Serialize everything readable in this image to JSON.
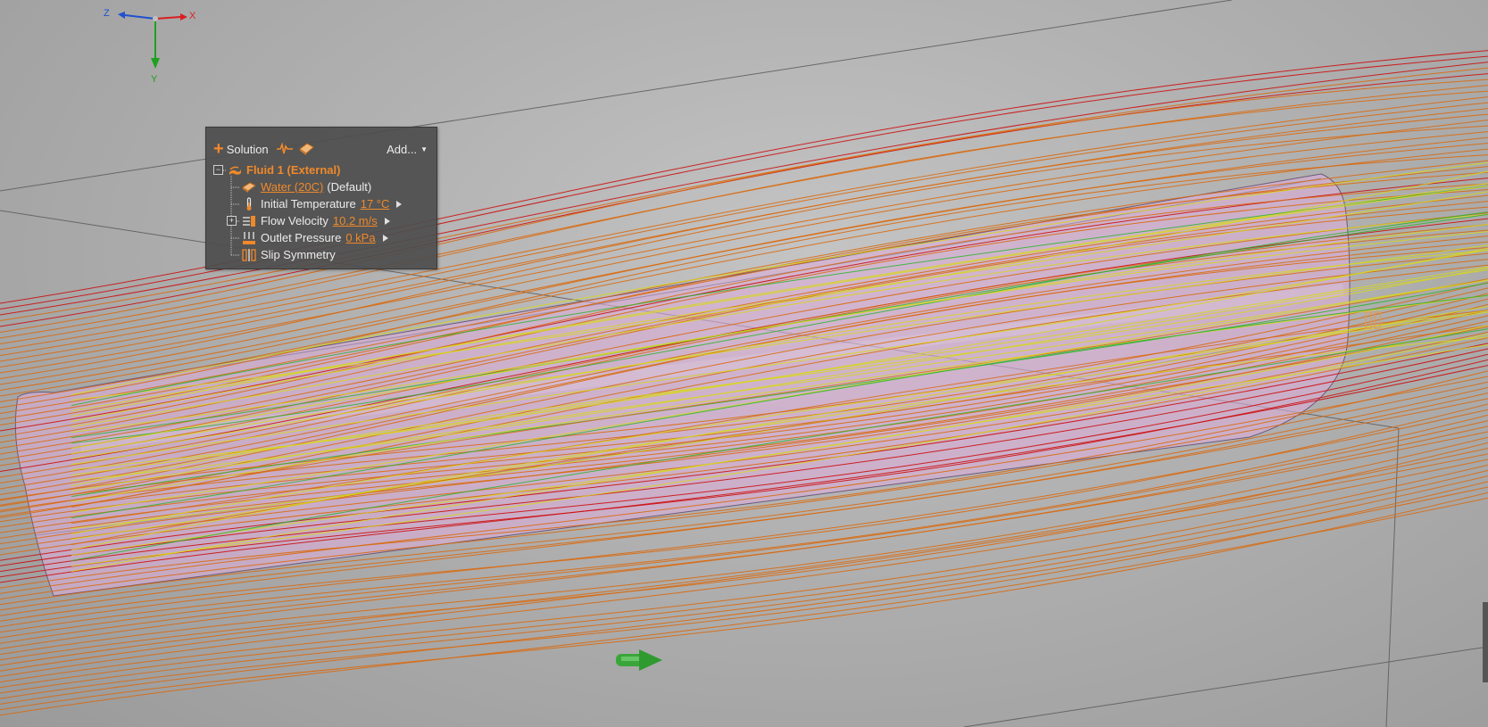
{
  "axis": {
    "x_label": "X",
    "y_label": "Y",
    "z_label": "Z"
  },
  "panel": {
    "header": {
      "solution_label": "Solution",
      "add_label": "Add..."
    },
    "fluid": {
      "label": "Fluid 1 (External)",
      "material": {
        "link": "Water (20C)",
        "suffix": "(Default)"
      },
      "rows": [
        {
          "label": "Initial Temperature",
          "value": "17 °C"
        },
        {
          "label": "Flow Velocity",
          "value": "10.2 m/s"
        },
        {
          "label": "Outlet Pressure",
          "value": "0 kPa"
        },
        {
          "label": "Slip Symmetry"
        }
      ]
    }
  },
  "colors": {
    "accent": "#f0892a",
    "panel_bg": "#4e4e4e",
    "streamline_orange": "#d96a10",
    "streamline_red": "#cc1010",
    "streamline_yellow": "#d8d818",
    "streamline_green": "#2cb42c",
    "hull": "#dcaed8"
  }
}
